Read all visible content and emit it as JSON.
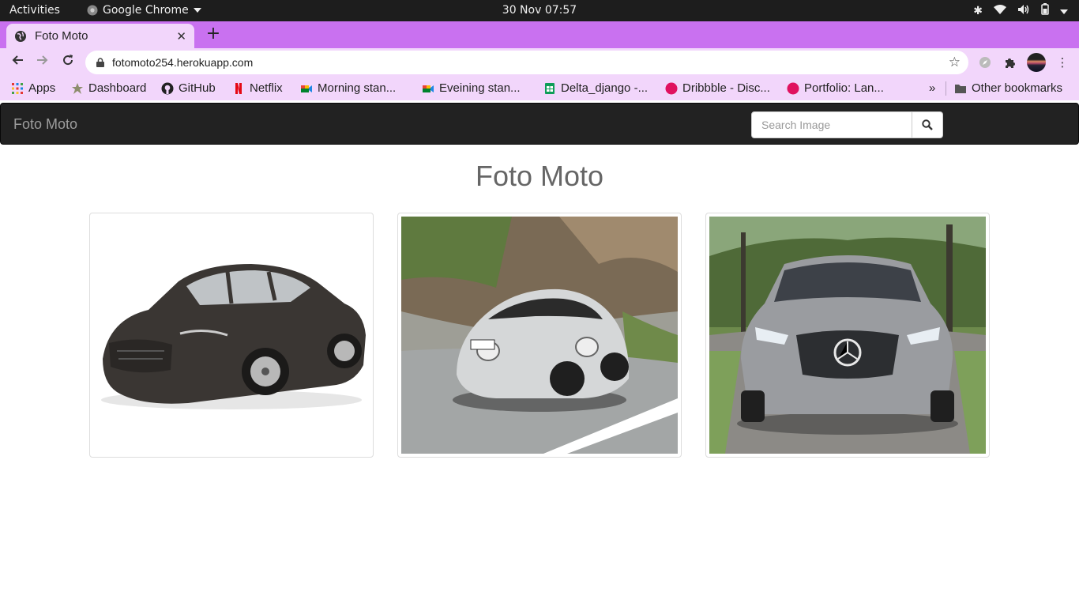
{
  "system": {
    "activities": "Activities",
    "app_name": "Google Chrome",
    "clock": "30 Nov  07:57"
  },
  "browser": {
    "tab_title": "Foto Moto",
    "url": "fotomoto254.herokuapp.com",
    "bookmarks": [
      {
        "label": "Apps",
        "icon": "apps-grid-icon"
      },
      {
        "label": "Dashboard",
        "icon": "dashboard-icon"
      },
      {
        "label": "GitHub",
        "icon": "github-icon"
      },
      {
        "label": "Netflix",
        "icon": "netflix-icon"
      },
      {
        "label": "Morning stan...",
        "icon": "google-meet-icon"
      },
      {
        "label": "Eveining stan...",
        "icon": "google-meet-icon"
      },
      {
        "label": "Delta_django -...",
        "icon": "google-sheets-icon"
      },
      {
        "label": "Dribbble - Disc...",
        "icon": "dribbble-icon"
      },
      {
        "label": "Portfolio: Lan...",
        "icon": "dribbble-icon"
      }
    ],
    "more_bookmarks": "»",
    "other_bookmarks": "Other bookmarks"
  },
  "site": {
    "brand": "Foto Moto",
    "search_placeholder": "Search Image",
    "heading": "Foto Moto",
    "images": [
      {
        "alt": "dark sedan car",
        "color": "#3a3633"
      },
      {
        "alt": "silver sports car on road",
        "color": "#d5d7d8"
      },
      {
        "alt": "silver hatchback car",
        "color": "#9a9ca0"
      }
    ]
  },
  "colors": {
    "tabstrip": "#c971f0",
    "toolbar": "#f2d6fb",
    "navbar": "#222222"
  }
}
